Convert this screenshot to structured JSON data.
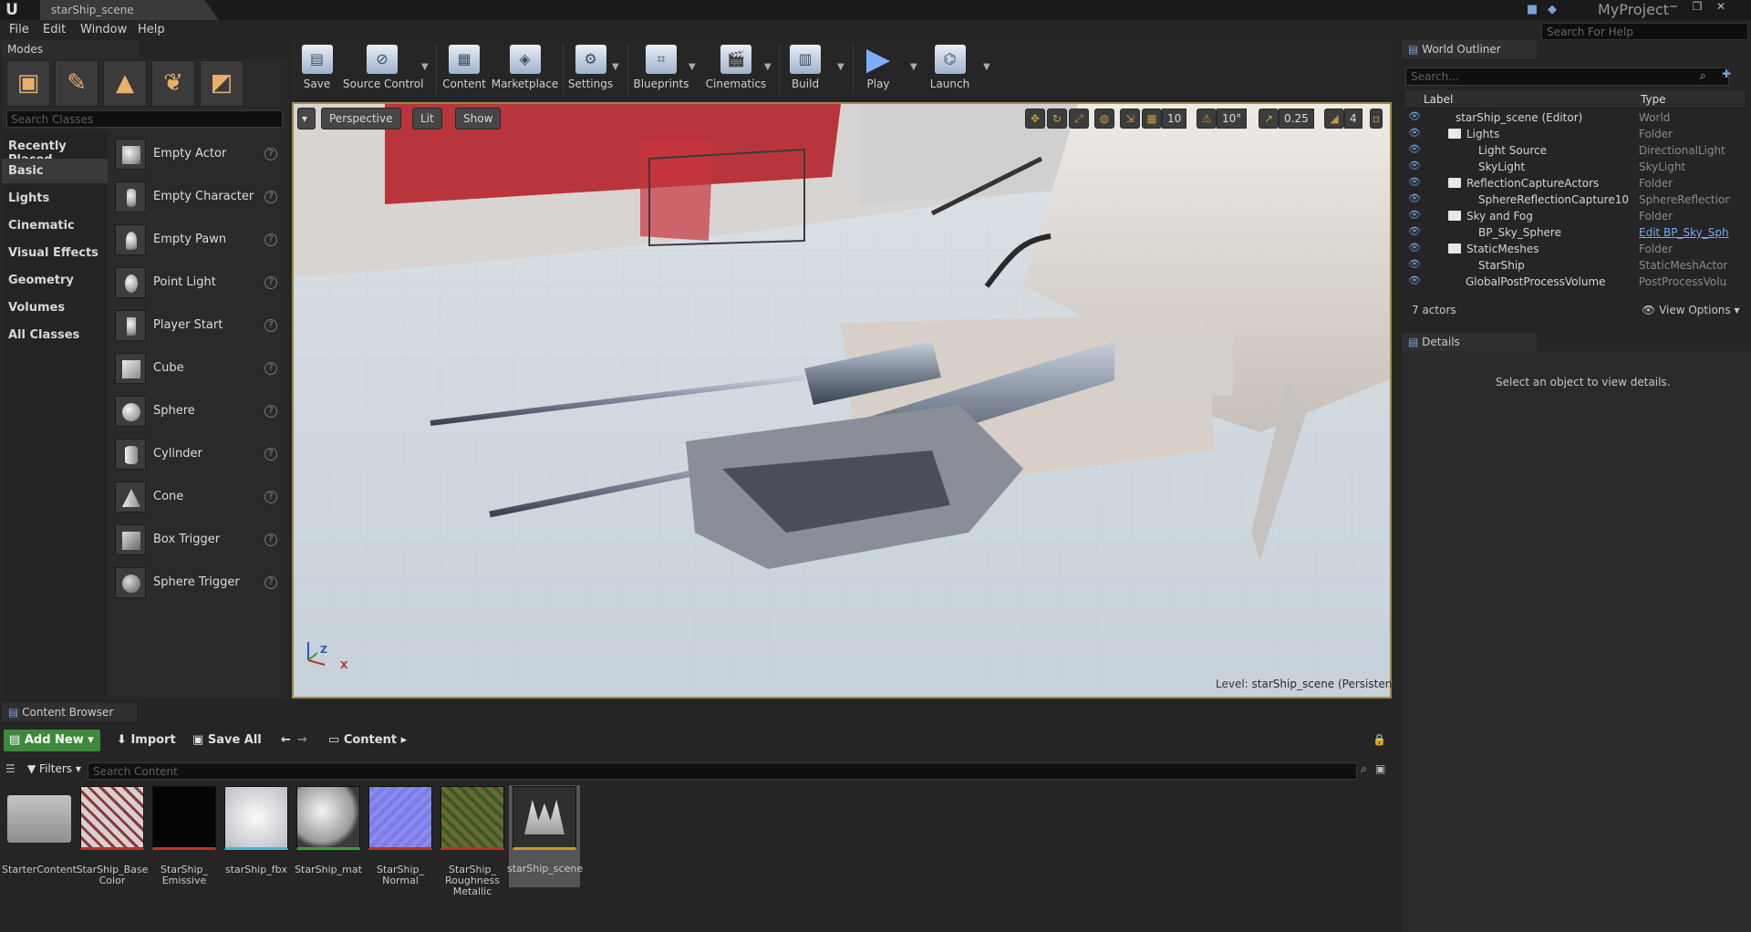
{
  "titlebar": {
    "doc_tab": "starShip_scene",
    "project": "MyProject"
  },
  "menu": [
    "File",
    "Edit",
    "Window",
    "Help"
  ],
  "help_search_placeholder": "Search For Help",
  "modes": {
    "tab": "Modes",
    "search_placeholder": "Search Classes",
    "categories": [
      "Recently Placed",
      "Basic",
      "Lights",
      "Cinematic",
      "Visual Effects",
      "Geometry",
      "Volumes",
      "All Classes"
    ],
    "selected_category": "Basic",
    "items": [
      "Empty Actor",
      "Empty Character",
      "Empty Pawn",
      "Point Light",
      "Player Start",
      "Cube",
      "Sphere",
      "Cylinder",
      "Cone",
      "Box Trigger",
      "Sphere Trigger"
    ]
  },
  "toolbar": {
    "buttons": [
      "Save",
      "Source Control",
      "Content",
      "Marketplace",
      "Settings",
      "Blueprints",
      "Cinematics",
      "Build",
      "Play",
      "Launch"
    ]
  },
  "viewport": {
    "perspective": "Perspective",
    "lit": "Lit",
    "show": "Show",
    "grid_snap": "10",
    "rotation_snap": "10°",
    "scale_snap": "0.25",
    "camera_speed": "4",
    "level_prefix": "Level:",
    "level_name": "starShip_scene (Persistent)",
    "axis_z": "Z",
    "axis_x": "X"
  },
  "world_outliner": {
    "tab": "World Outliner",
    "search_placeholder": "Search...",
    "col_label": "Label",
    "col_type": "Type",
    "rows": [
      {
        "label": "starShip_scene (Editor)",
        "type": "World"
      },
      {
        "label": "Lights",
        "type": "Folder"
      },
      {
        "label": "Light Source",
        "type": "DirectionalLight"
      },
      {
        "label": "SkyLight",
        "type": "SkyLight"
      },
      {
        "label": "ReflectionCaptureActors",
        "type": "Folder"
      },
      {
        "label": "SphereReflectionCapture10",
        "type": "SphereReflectionC"
      },
      {
        "label": "Sky and Fog",
        "type": "Folder"
      },
      {
        "label": "BP_Sky_Sphere",
        "type": "Edit BP_Sky_Sph"
      },
      {
        "label": "StaticMeshes",
        "type": "Folder"
      },
      {
        "label": "StarShip",
        "type": "StaticMeshActor"
      },
      {
        "label": "GlobalPostProcessVolume",
        "type": "PostProcessVolu"
      }
    ],
    "actor_count": "7 actors",
    "view_options": "View Options"
  },
  "details": {
    "tab": "Details",
    "message": "Select an object to view details."
  },
  "content_browser": {
    "tab": "Content Browser",
    "add_new": "Add New",
    "import": "Import",
    "save_all": "Save All",
    "path": "Content",
    "filters": "Filters",
    "search_placeholder": "Search Content",
    "assets": [
      {
        "name": "StarterContent",
        "color": "#bfbfbf"
      },
      {
        "name": "StarShip_Base Color",
        "color": "#c9c2c2"
      },
      {
        "name": "StarShip_ Emissive",
        "color": "#050505"
      },
      {
        "name": "starShip_fbx",
        "color": "#c8c8cc"
      },
      {
        "name": "StarShip_mat",
        "color": "#d2d2d2"
      },
      {
        "name": "StarShip_ Normal",
        "color": "#7a7ae8"
      },
      {
        "name": "StarShip_ Roughness Metallic",
        "color": "#6a6a32"
      },
      {
        "name": "starShip_scene",
        "color": "#2f2f2f"
      }
    ],
    "selected_asset": "starShip_scene"
  }
}
